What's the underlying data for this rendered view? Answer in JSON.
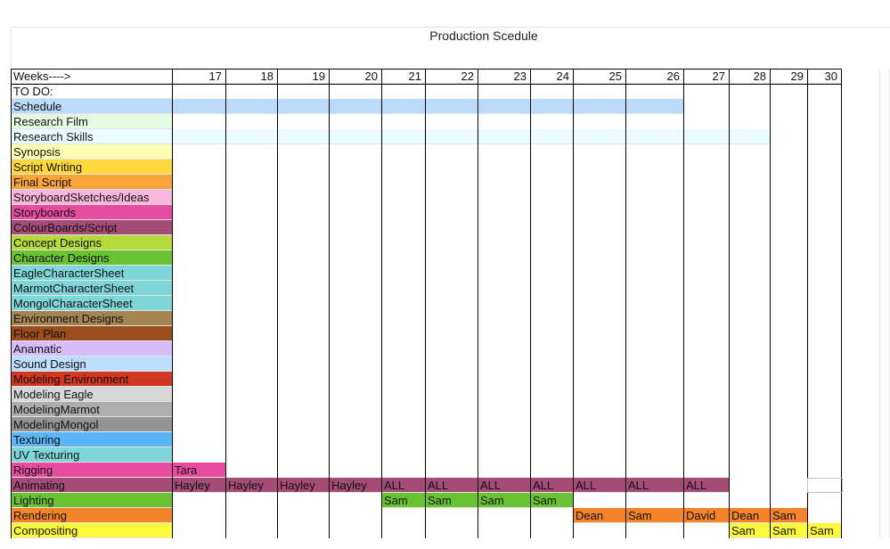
{
  "title": "Production Scedule",
  "header": {
    "label": "Weeks---->",
    "weeks": [
      "17",
      "18",
      "19",
      "20",
      "21",
      "22",
      "23",
      "24",
      "25",
      "26",
      "27",
      "28",
      "29",
      "30"
    ]
  },
  "todo_label": "TO DO:",
  "tasks": [
    {
      "name": "Schedule",
      "color": "#bcdaf9",
      "bar": {
        "from": 0,
        "to": 9,
        "color": "#bcdaf9"
      },
      "cells": []
    },
    {
      "name": "Research Film",
      "color": "#e5fbe2",
      "cells": []
    },
    {
      "name": "Research Skills",
      "color": "#eafcfd",
      "bar": {
        "from": 0,
        "to": 11,
        "color": "#eafcfd"
      },
      "cells": []
    },
    {
      "name": "Synopsis",
      "color": "#fefeb2",
      "cells": []
    },
    {
      "name": "Script Writing",
      "color": "#fdd83c",
      "cells": []
    },
    {
      "name": "Final Script",
      "color": "#fba43a",
      "cells": []
    },
    {
      "name": "StoryboardSketches/Ideas",
      "color": "#f7b6da",
      "cells": []
    },
    {
      "name": "Storyboards",
      "color": "#e74ca0",
      "cells": []
    },
    {
      "name": "ColourBoards/Script",
      "color": "#a44b76",
      "cells": []
    },
    {
      "name": "Concept Designs",
      "color": "#b6d93b",
      "cells": []
    },
    {
      "name": "Character Designs",
      "color": "#69c232",
      "cells": []
    },
    {
      "name": "EagleCharacterSheet",
      "color": "#7fd6d9",
      "cells": []
    },
    {
      "name": "MarmotCharacterSheet",
      "color": "#7fd6d9",
      "cells": []
    },
    {
      "name": "MongolCharacterSheet",
      "color": "#7fd6d9",
      "cells": []
    },
    {
      "name": "Environment Designs",
      "color": "#a48552",
      "cells": []
    },
    {
      "name": "Floor Plan",
      "color": "#9c4b1b",
      "cells": []
    },
    {
      "name": "Anamatic",
      "color": "#d7bdfd",
      "cells": []
    },
    {
      "name": "Sound Design",
      "color": "#bddefd",
      "cells": []
    },
    {
      "name": "Modeling Environment",
      "color": "#d23722",
      "cells": []
    },
    {
      "name": "Modeling Eagle",
      "color": "#d7d7d7",
      "cells": []
    },
    {
      "name": "ModelingMarmot",
      "color": "#adadad",
      "cells": []
    },
    {
      "name": "ModelingMongol",
      "color": "#949494",
      "cells": []
    },
    {
      "name": "Texturing",
      "color": "#5ab6f6",
      "cells": []
    },
    {
      "name": "UV Texturing",
      "color": "#7fd6d9",
      "cells": []
    },
    {
      "name": "Rigging",
      "color": "#e74ca0",
      "cells": [
        {
          "col": 0,
          "text": "Tara",
          "color": "#e74ca0"
        }
      ]
    },
    {
      "name": "Animating",
      "color": "#a44b76",
      "cells": [
        {
          "col": 0,
          "text": "Hayley",
          "color": "#a44b76"
        },
        {
          "col": 1,
          "text": "Hayley",
          "color": "#a44b76"
        },
        {
          "col": 2,
          "text": "Hayley",
          "color": "#a44b76"
        },
        {
          "col": 3,
          "text": "Hayley",
          "color": "#a44b76"
        },
        {
          "col": 4,
          "text": "ALL",
          "color": "#a44b76"
        },
        {
          "col": 5,
          "text": "ALL",
          "color": "#a44b76"
        },
        {
          "col": 6,
          "text": "ALL",
          "color": "#a44b76"
        },
        {
          "col": 7,
          "text": "ALL",
          "color": "#a44b76"
        },
        {
          "col": 8,
          "text": "ALL",
          "color": "#a44b76"
        },
        {
          "col": 9,
          "text": "ALL",
          "color": "#a44b76"
        },
        {
          "col": 10,
          "text": "ALL",
          "color": "#a44b76"
        }
      ]
    },
    {
      "name": "Lighting",
      "color": "#69c232",
      "cells": [
        {
          "col": 4,
          "text": "Sam",
          "color": "#69c232"
        },
        {
          "col": 5,
          "text": "Sam",
          "color": "#69c232"
        },
        {
          "col": 6,
          "text": "Sam",
          "color": "#69c232"
        },
        {
          "col": 7,
          "text": "Sam",
          "color": "#69c232"
        }
      ]
    },
    {
      "name": "Rendering",
      "color": "#f4832a",
      "cells": [
        {
          "col": 8,
          "text": "Dean",
          "color": "#f4832a"
        },
        {
          "col": 9,
          "text": "Sam",
          "color": "#f4832a"
        },
        {
          "col": 10,
          "text": "David",
          "color": "#f4832a"
        },
        {
          "col": 11,
          "text": "Dean",
          "color": "#f4832a"
        },
        {
          "col": 12,
          "text": "Sam",
          "color": "#f4832a"
        }
      ]
    },
    {
      "name": "Compositing",
      "color": "#fdfa3e",
      "cells": [
        {
          "col": 11,
          "text": "Sam",
          "color": "#fdfa3e"
        },
        {
          "col": 12,
          "text": "Sam",
          "color": "#fdfa3e"
        },
        {
          "col": 13,
          "text": "Sam",
          "color": "#fdfa3e"
        }
      ]
    }
  ]
}
